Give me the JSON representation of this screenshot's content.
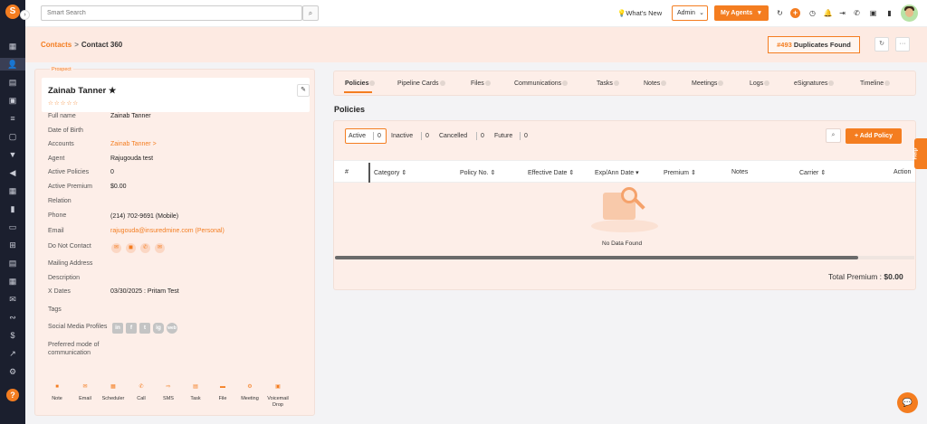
{
  "topbar": {
    "search_placeholder": "Smart Search",
    "whats_new": "What's New",
    "role_select": "Admin",
    "agents_button": "My Agents"
  },
  "breadcrumb": {
    "parent": "Contacts",
    "separator": ">",
    "current": "Contact 360"
  },
  "duplicates": {
    "count": "#493",
    "label": "Duplicates Found"
  },
  "contact": {
    "status": "Prospect",
    "name": "Zainab Tanner",
    "rating": "☆☆☆☆☆",
    "fields": [
      {
        "label": "Full name",
        "value": "Zainab Tanner"
      },
      {
        "label": "Date of Birth",
        "value": ""
      },
      {
        "label": "Accounts",
        "value": "Zainab Tanner >"
      },
      {
        "label": "Agent",
        "value": "Rajugouda test"
      },
      {
        "label": "Active Policies",
        "value": "0"
      },
      {
        "label": "Active Premium",
        "value": "$0.00"
      },
      {
        "label": "Relation",
        "value": ""
      },
      {
        "label": "Phone",
        "value": "(214) 702-9691 (Mobile)"
      },
      {
        "label": "Email",
        "value": "rajugouda@insuredmine.com (Personal)"
      },
      {
        "label": "Do Not Contact",
        "value": ""
      },
      {
        "label": "Mailing Address",
        "value": ""
      },
      {
        "label": "Description",
        "value": ""
      },
      {
        "label": "X Dates",
        "value": "03/30/2025 : Pritam Test"
      },
      {
        "label": "Tags",
        "value": ""
      },
      {
        "label": "Social Media Profiles",
        "value": ""
      },
      {
        "label": "Preferred mode of communication",
        "value": ""
      }
    ],
    "social": [
      "in",
      "f",
      "t",
      "ig",
      "web"
    ],
    "actions": [
      {
        "label": "Note",
        "icon": "note-icon"
      },
      {
        "label": "Email",
        "icon": "email-icon"
      },
      {
        "label": "Scheduler",
        "icon": "calendar-icon"
      },
      {
        "label": "Call",
        "icon": "phone-icon"
      },
      {
        "label": "SMS",
        "icon": "sms-icon"
      },
      {
        "label": "Task",
        "icon": "task-icon"
      },
      {
        "label": "File",
        "icon": "folder-icon"
      },
      {
        "label": "Meeting",
        "icon": "meeting-icon"
      },
      {
        "label": "Voicemail Drop",
        "icon": "voicemail-icon"
      }
    ]
  },
  "tabs": [
    "Policies",
    "Pipeline Cards",
    "Files",
    "Communications",
    "Tasks",
    "Notes",
    "Meetings",
    "Logs",
    "eSignatures",
    "Timeline"
  ],
  "policies": {
    "title": "Policies",
    "filters": [
      {
        "label": "Active",
        "count": "0"
      },
      {
        "label": "Inactive",
        "count": "0"
      },
      {
        "label": "Cancelled",
        "count": "0"
      },
      {
        "label": "Future",
        "count": "0"
      }
    ],
    "add_button": "+ Add Policy",
    "columns": [
      "#",
      "Category ⇕",
      "Policy No. ⇕",
      "Effective Date ⇕",
      "Exp/Ann Date ▾",
      "Premium ⇕",
      "Notes",
      "Carrier ⇕",
      "Action"
    ],
    "empty_text": "No Data Found",
    "total_label": "Total Premium :",
    "total_value": "$0.00"
  },
  "help_tab": "Help",
  "colors": {
    "accent": "#f47d20",
    "sidebar": "#1b1f2e",
    "panel": "#fdeee8"
  }
}
